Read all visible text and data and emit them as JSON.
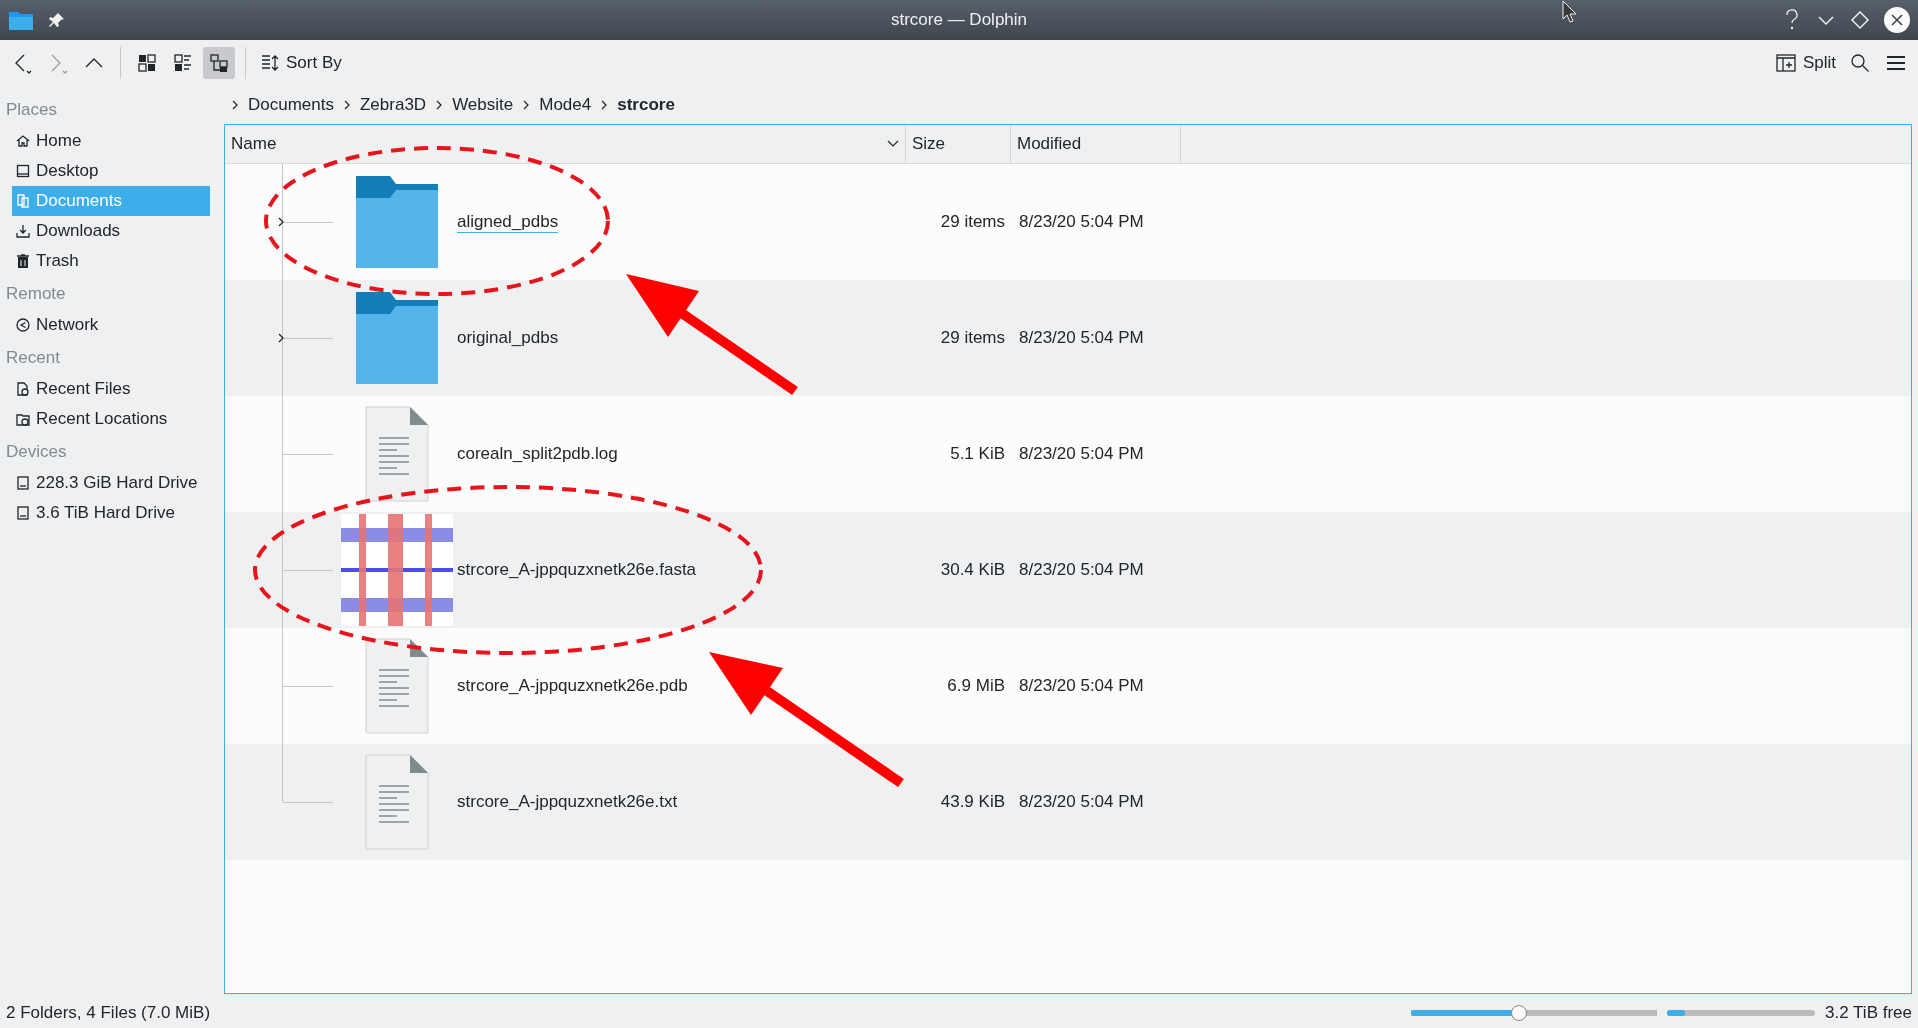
{
  "window": {
    "title": "strcore — Dolphin",
    "controls": [
      {
        "kind": "help"
      },
      {
        "kind": "minimize"
      },
      {
        "kind": "maximize"
      },
      {
        "kind": "close"
      }
    ]
  },
  "toolbar": {
    "nav": [
      {
        "kind": "back",
        "disabled": false
      },
      {
        "kind": "forward",
        "disabled": true
      },
      {
        "kind": "up",
        "disabled": false
      }
    ],
    "view_modes": [
      {
        "kind": "icons",
        "selected": false
      },
      {
        "kind": "compact",
        "selected": false
      },
      {
        "kind": "details",
        "selected": true
      }
    ],
    "sort_by": "Sort By",
    "split": "Split"
  },
  "breadcrumb": [
    {
      "label": "Documents",
      "current": false
    },
    {
      "label": "Zebra3D",
      "current": false
    },
    {
      "label": "Website",
      "current": false
    },
    {
      "label": "Mode4",
      "current": false
    },
    {
      "label": "strcore",
      "current": true
    }
  ],
  "sidebar": [
    {
      "heading": "Places",
      "items": [
        {
          "label": "Home",
          "kind": "home",
          "selected": false
        },
        {
          "label": "Desktop",
          "kind": "desktop",
          "selected": false
        },
        {
          "label": "Documents",
          "kind": "documents",
          "selected": true
        },
        {
          "label": "Downloads",
          "kind": "downloads",
          "selected": false
        },
        {
          "label": "Trash",
          "kind": "trash",
          "selected": false
        }
      ]
    },
    {
      "heading": "Remote",
      "items": [
        {
          "label": "Network",
          "kind": "network",
          "selected": false
        }
      ]
    },
    {
      "heading": "Recent",
      "items": [
        {
          "label": "Recent Files",
          "kind": "recent-files",
          "selected": false
        },
        {
          "label": "Recent Locations",
          "kind": "recent-locations",
          "selected": false
        }
      ]
    },
    {
      "heading": "Devices",
      "items": [
        {
          "label": "228.3 GiB Hard Drive",
          "kind": "drive",
          "selected": false
        },
        {
          "label": "3.6 TiB Hard Drive",
          "kind": "drive",
          "selected": false
        }
      ]
    }
  ],
  "table": {
    "columns": [
      {
        "label": "Name",
        "sorted": true
      },
      {
        "label": "Size",
        "sorted": false
      },
      {
        "label": "Modified",
        "sorted": false
      }
    ],
    "rows": [
      {
        "name": "aligned_pdbs",
        "kind": "folder",
        "size": "29 items",
        "modified": "8/23/20 5:04 PM",
        "expandable": true,
        "hovered": true
      },
      {
        "name": "original_pdbs",
        "kind": "folder",
        "size": "29 items",
        "modified": "8/23/20 5:04 PM",
        "expandable": true,
        "hovered": false
      },
      {
        "name": "corealn_split2pdb.log",
        "kind": "text",
        "size": "5.1 KiB",
        "modified": "8/23/20 5:04 PM",
        "expandable": false,
        "hovered": false
      },
      {
        "name": "strcore_A-jppquzxnetk26e.fasta",
        "kind": "image",
        "size": "30.4 KiB",
        "modified": "8/23/20 5:04 PM",
        "expandable": false,
        "hovered": false
      },
      {
        "name": "strcore_A-jppquzxnetk26e.pdb",
        "kind": "text",
        "size": "6.9 MiB",
        "modified": "8/23/20 5:04 PM",
        "expandable": false,
        "hovered": false
      },
      {
        "name": "strcore_A-jppquzxnetk26e.txt",
        "kind": "text",
        "size": "43.9 KiB",
        "modified": "8/23/20 5:04 PM",
        "expandable": false,
        "hovered": false
      }
    ]
  },
  "status_bar": {
    "text": "2 Folders, 4 Files (7.0 MiB)",
    "zoom": {
      "level": 0.44
    },
    "free_space": {
      "label": "3.2 TiB free",
      "level": 0.12
    }
  }
}
